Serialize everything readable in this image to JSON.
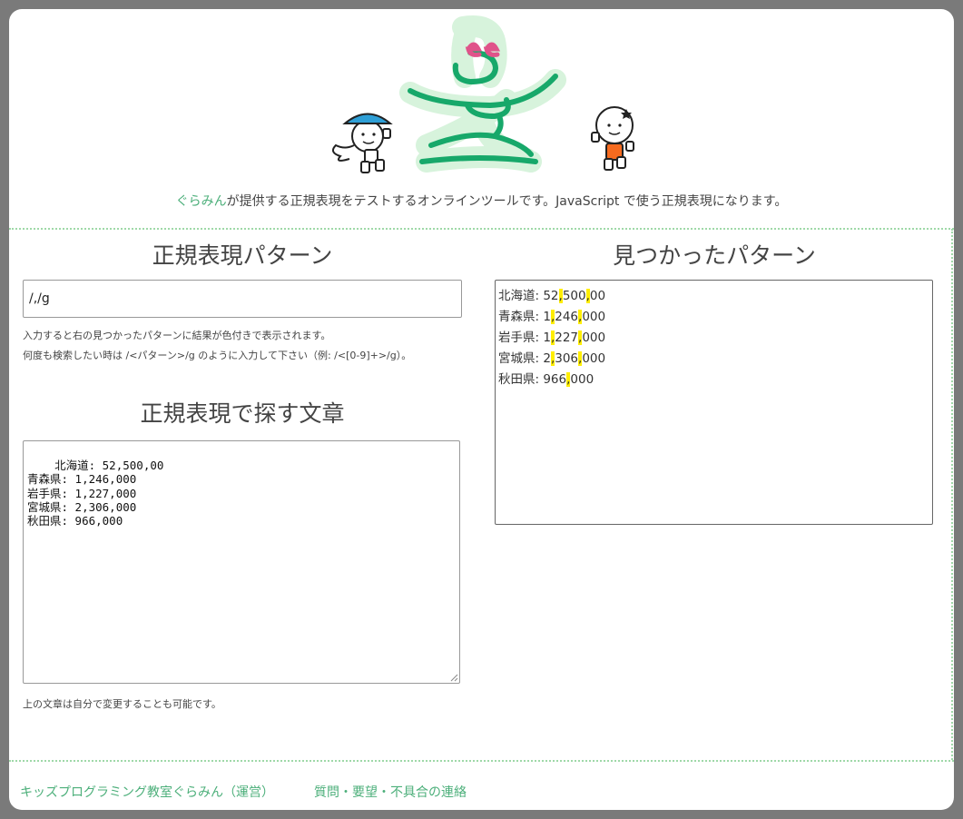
{
  "header": {
    "brand_link": "ぐらみん",
    "tagline_rest": "が提供する正規表現をテストするオンラインツールです。JavaScript で使う正規表現になります。"
  },
  "left": {
    "pattern_title": "正規表現パターン",
    "pattern_value": "/,/g",
    "hint1": "入力すると右の見つかったパターンに結果が色付きで表示されます。",
    "hint2": "何度も検索したい時は /<パターン>/g のように入力して下さい（例: /<[0-9]+>/g）。",
    "text_title": "正規表現で探す文章",
    "text_value": "北海道: 52,500,00\n青森県: 1,246,000\n岩手県: 1,227,000\n宮城県: 2,306,000\n秋田県: 966,000",
    "text_hint": "上の文章は自分で変更することも可能です。"
  },
  "right": {
    "found_title": "見つかったパターン",
    "lines": [
      [
        "北海道: 52",
        ",",
        "500",
        ",",
        "00"
      ],
      [
        "青森県: 1",
        ",",
        "246",
        ",",
        "000"
      ],
      [
        "岩手県: 1",
        ",",
        "227",
        ",",
        "000"
      ],
      [
        "宮城県: 2",
        ",",
        "306",
        ",",
        "000"
      ],
      [
        "秋田県: 966",
        ",",
        "000"
      ]
    ]
  },
  "footer": {
    "link1": "キッズプログラミング教室ぐらみん（運営）",
    "link2": "質問・要望・不具合の連絡"
  },
  "colors": {
    "brand_green": "#4caf7a",
    "highlight": "#ffee00",
    "separator": "#9fd9a8"
  }
}
